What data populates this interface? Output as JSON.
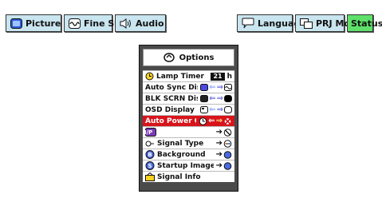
{
  "tabs": [
    {
      "label": "Picture",
      "icon": "picture-icon"
    },
    {
      "label": "Fine Sync",
      "icon": "fine-sync-icon"
    },
    {
      "label": "Audio",
      "icon": "speaker-icon"
    },
    {
      "label": "Language",
      "icon": "speech-bubble-icon"
    },
    {
      "label": "PRJ Mode",
      "icon": "projector-mode-icon"
    },
    {
      "label": "Status",
      "icon": null
    }
  ],
  "active_tab": "Status",
  "menu": {
    "title": "Options",
    "items": [
      {
        "label": "Lamp Timer",
        "value": "21",
        "unit": "h"
      },
      {
        "label": "Auto Sync Disp"
      },
      {
        "label": "BLK SCRN Disp"
      },
      {
        "label": "OSD Display"
      },
      {
        "label": "Auto Power Off"
      },
      {
        "label": "I/P"
      },
      {
        "label": "Signal Type"
      },
      {
        "label": "Background"
      },
      {
        "label": "Startup Image"
      },
      {
        "label": "Signal Info"
      }
    ],
    "selected_item": "Auto Power Off"
  },
  "colors": {
    "tab_bg": "#c9e5ef",
    "tab_active_bg": "#5ee06a",
    "menu_frame": "#4a4a4a",
    "selected_row": "#d8141b"
  }
}
